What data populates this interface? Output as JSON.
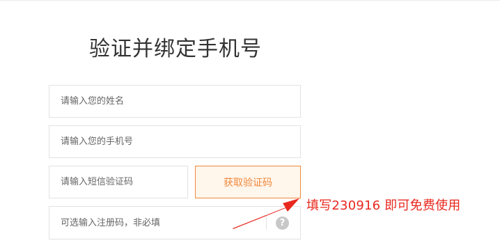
{
  "page": {
    "title": "验证并绑定手机号"
  },
  "form": {
    "name_placeholder": "请输入您的姓名",
    "phone_placeholder": "请输入您的手机号",
    "sms_placeholder": "请输入短信验证码",
    "get_code_label": "获取验证码",
    "reg_code_placeholder": "可选输入注册码，非必填",
    "help_icon_glyph": "?"
  },
  "annotation": {
    "text": "填写230916 即可免费使用",
    "color": "#e8281e"
  },
  "colors": {
    "accent": "#f0883a",
    "accent_bg": "#fff6ec",
    "border": "#e2e2e2"
  }
}
